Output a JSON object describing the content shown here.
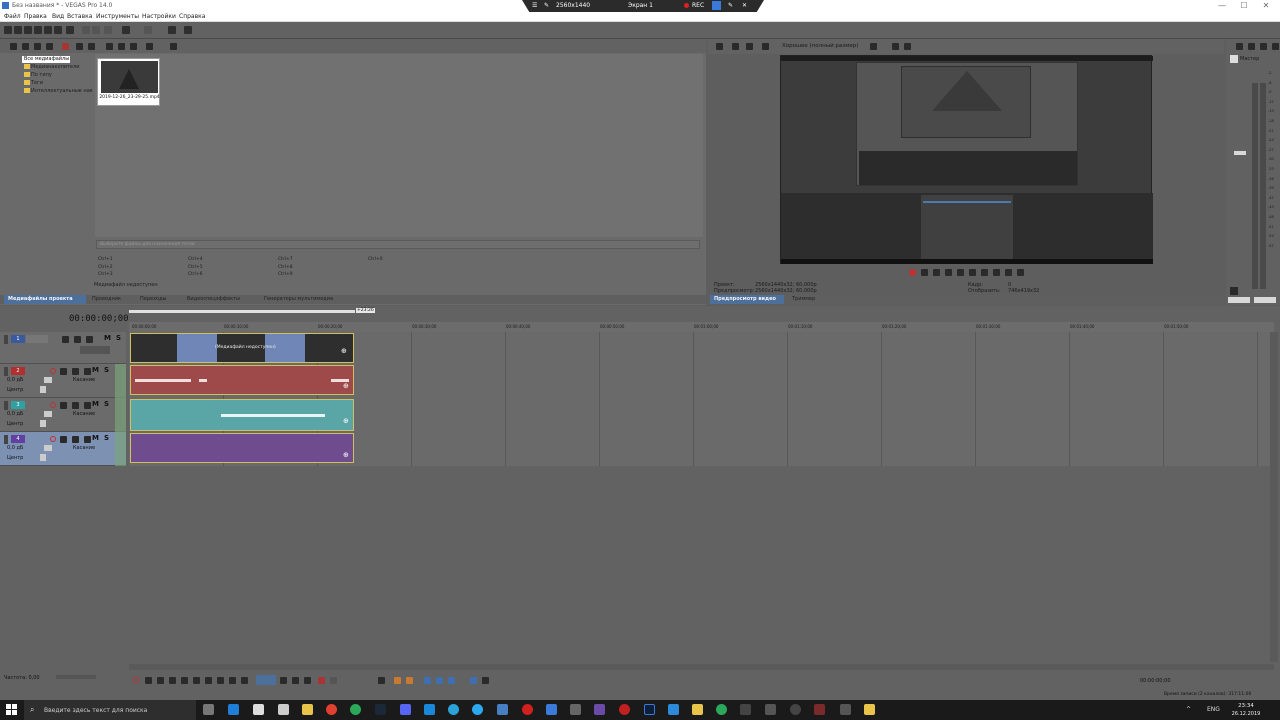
{
  "window": {
    "title": "Без названия * - VEGAS Pro 14.0",
    "controls": {
      "minimize": "—",
      "maximize": "☐",
      "close": "✕"
    }
  },
  "obs_overlay": {
    "resolution": "2560x1440",
    "screen": "Экран 1",
    "rec": "REC"
  },
  "menu": {
    "items": [
      "Файл",
      "Правка",
      "Вид",
      "Вставка",
      "Инструменты",
      "Настройки",
      "Справка"
    ]
  },
  "media_tree": {
    "items": [
      "Все медиафайлы",
      "Медианакопители",
      "По типу",
      "Теги",
      "Интеллектуальные нак"
    ]
  },
  "media_file": {
    "name": "2019-12-26_23-29-25.mp4"
  },
  "media_search": {
    "placeholder": "Выберите файлы для назначения тегов"
  },
  "shortcuts": [
    "Ctrl+1",
    "Ctrl+4",
    "Ctrl+7",
    "Ctrl+0",
    "Ctrl+2",
    "Ctrl+5",
    "Ctrl+8",
    "Ctrl+3",
    "Ctrl+6",
    "Ctrl+9"
  ],
  "media_status": "Медиафайл недоступен",
  "left_tabs": [
    "Медиафайлы проекта",
    "Проводник",
    "Переходы",
    "Видеоспецэффекты",
    "Генераторы мультимедиа"
  ],
  "preview": {
    "quality": "Хорошее (полный размер)",
    "project_label": "Проект:",
    "project_value": "2560x1440x32; 60,000p",
    "preview_label": "Предпросмотр:",
    "preview_value": "2560x1440x32; 60,000p",
    "frame_label": "Кадр:",
    "frame_value": "0",
    "display_label": "Отобразить:",
    "display_value": "746x419x32",
    "tabs": [
      "Предпросмотр видео",
      "Триммер"
    ]
  },
  "master": {
    "title": "Мастер",
    "scale": [
      "-2",
      "-6",
      "-9",
      "-12",
      "-15",
      "-18",
      "-21",
      "-24",
      "-27",
      "-30",
      "-33",
      "-36",
      "-39",
      "-42",
      "-45",
      "-48",
      "-51",
      "-54",
      "-57"
    ]
  },
  "timeline": {
    "timecode": "00:00:00;00",
    "ruler": [
      "00:00:00;00",
      "00:00:10;00",
      "00:00:20;00",
      "00:00:30;00",
      "00:00:40;00",
      "00:00:50;00",
      "00:01:00;00",
      "00:01:10;00",
      "00:01:20;00",
      "00:01:30;00",
      "00:01:40;00",
      "00:01:50;00"
    ],
    "marker": "+23:26",
    "offline_label": "(Медиафайл недоступен)",
    "tracks": [
      {
        "num": "1",
        "type": "video",
        "color": "#3a5aa0"
      },
      {
        "num": "2",
        "type": "audio",
        "color": "#b03030",
        "vol": "0,0 дБ",
        "pan": "Центр",
        "mode": "Касание"
      },
      {
        "num": "3",
        "type": "audio",
        "color": "#30a0a0",
        "vol": "0,0 дБ",
        "pan": "Центр",
        "mode": "Касание"
      },
      {
        "num": "4",
        "type": "audio",
        "color": "#6040a0",
        "vol": "0,0 дБ",
        "pan": "Центр",
        "mode": "Касание"
      }
    ],
    "mute": "M",
    "solo": "S",
    "rate": "Частота: 0,00",
    "end_time": "00:00:00;00",
    "record_time": "Время записи (2 каналов): 317:11:00"
  },
  "taskbar": {
    "search_placeholder": "Введите здесь текст для поиска",
    "lang": "ENG",
    "time": "23:34",
    "date": "26.12.2019"
  },
  "colors": {
    "accent": "#4d6f9b",
    "video_track": "#6f86b6",
    "audio2": "#9e4a4a",
    "audio3": "#5aa5a5",
    "audio4": "#6e4c8e"
  }
}
